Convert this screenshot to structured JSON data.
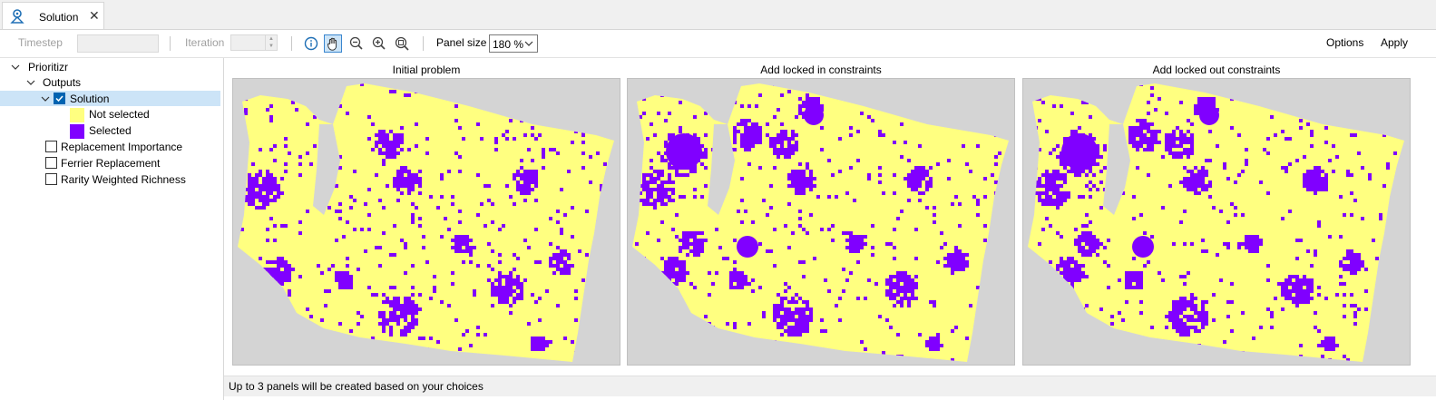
{
  "tab": {
    "label": "Solution",
    "close_glyph": "✕",
    "icon": "map-pin-icon"
  },
  "toolbar": {
    "timestep_label": "Timestep",
    "iteration_label": "Iteration",
    "panel_size_label": "Panel size",
    "panel_size_value": "180 %",
    "options_label": "Options",
    "apply_label": "Apply",
    "tools": [
      "info-icon",
      "pan-hand-icon",
      "zoom-out-icon",
      "zoom-in-icon",
      "zoom-extent-icon"
    ]
  },
  "tree": {
    "root": "Prioritizr",
    "outputs": "Outputs",
    "solution": "Solution",
    "legend": [
      {
        "label": "Not selected",
        "color": "#ffff80"
      },
      {
        "label": "Selected",
        "color": "#8000ff"
      }
    ],
    "layers": [
      "Replacement Importance",
      "Ferrier Replacement",
      "Rarity Weighted Richness"
    ]
  },
  "panels": [
    {
      "title": "Initial problem"
    },
    {
      "title": "Add locked in constraints"
    },
    {
      "title": "Add locked out constraints"
    }
  ],
  "status": {
    "text": "Up to 3 panels will be created based on your choices"
  },
  "colors": {
    "accent": "#0063b1",
    "selection_bg": "#cce4f7",
    "map_bg": "#d4d4d4",
    "not_selected": "#ffff80",
    "selected": "#8000ff"
  }
}
